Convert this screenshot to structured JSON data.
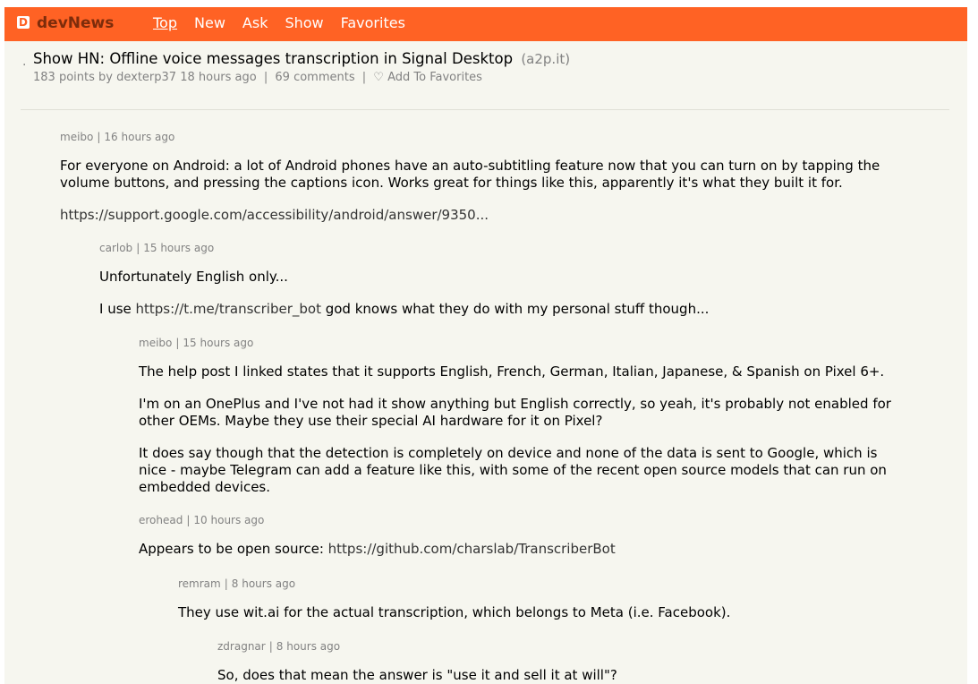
{
  "colors": {
    "topbar": "#ff6224",
    "brand_text": "#7d2c0b",
    "page_bg": "#f6f6ef",
    "meta_text": "#828282"
  },
  "header": {
    "logo_icon": "D",
    "brand": "devNews",
    "nav": [
      {
        "label": "Top",
        "active": true
      },
      {
        "label": "New",
        "active": false
      },
      {
        "label": "Ask",
        "active": false
      },
      {
        "label": "Show",
        "active": false
      },
      {
        "label": "Favorites",
        "active": false
      }
    ]
  },
  "story": {
    "bullet": ".",
    "title": "Show HN: Offline voice messages transcription in Signal Desktop",
    "domain": "(a2p.it)",
    "points": "183 points",
    "by": "by",
    "author": "dexterp37",
    "age": "18 hours ago",
    "comments": "69 comments",
    "favorite_icon": "heart-outline-icon",
    "favorite_glyph": "♡",
    "favorite_label": "Add To Favorites"
  },
  "comments": [
    {
      "user": "meibo",
      "age": "16 hours ago",
      "lines": [
        "For everyone on Android: a lot of Android phones have an auto-subtitling feature now that you can turn on by tapping the",
        "volume buttons, and pressing the captions icon. Works great for things like this, apparently it's what they built it for."
      ],
      "link": "https://support.google.com/accessibility/android/answer/9350..."
    },
    {
      "user": "carlob",
      "age": "15 hours ago",
      "para1": "Unfortunately English only...",
      "para2_before": "I use ",
      "para2_link": "https://t.me/transcriber_bot",
      "para2_after": " god knows what they do with my personal stuff though..."
    },
    {
      "user": "meibo",
      "age": "15 hours ago",
      "para1": "The help post I linked states that it supports English, French, German, Italian, Japanese, & Spanish on Pixel 6+.",
      "para2": [
        "I'm on an OnePlus and I've not had it show anything but English correctly, so yeah, it's probably not enabled for",
        "other OEMs. Maybe they use their special AI hardware for it on Pixel?"
      ],
      "para3": [
        "It does say though that the detection is completely on device and none of the data is sent to Google, which is",
        "nice - maybe Telegram can add a feature like this, with some of the recent open source models that can run on",
        "embedded devices."
      ]
    },
    {
      "user": "erohead",
      "age": "10 hours ago",
      "para1_before": "Appears to be open source: ",
      "para1_link": "https://github.com/charslab/TranscriberBot"
    },
    {
      "user": "remram",
      "age": "8 hours ago",
      "para1": "They use wit.ai for the actual transcription, which belongs to Meta (i.e. Facebook)."
    },
    {
      "user": "zdragnar",
      "age": "8 hours ago",
      "para1": "So, does that mean the answer is \"use it and sell it at will\"?"
    }
  ],
  "separator": "|"
}
